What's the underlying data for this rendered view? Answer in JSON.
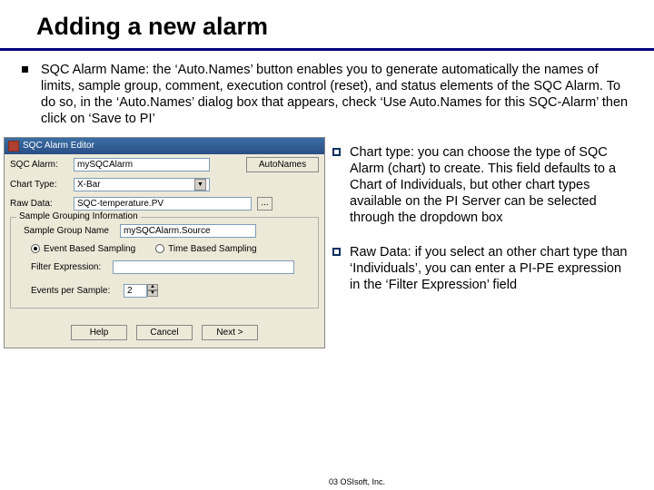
{
  "title": "Adding a new alarm",
  "bullet_main": "SQC Alarm Name: the ‘Auto.Names’ button enables you to generate automatically the names of limits, sample group, comment, execution control (reset), and status elements of the SQC Alarm. To do so, in the ‘Auto.Names’ dialog box that appears, check ‘Use Auto.Names for this SQC-Alarm’ then click on ‘Save to PI’",
  "right_bullets": [
    "Chart type: you can choose the type of SQC Alarm (chart) to create. This field defaults to a Chart of Individuals, but other chart types available on the PI Server can be selected through the dropdown box",
    "Raw Data: if you select an other chart type than ‘Individuals’, you can enter a PI-PE expression in the ‘Filter Expression’ field"
  ],
  "dialog": {
    "title": "SQC Alarm Editor",
    "labels": {
      "sqc_alarm": "SQC Alarm:",
      "chart_type": "Chart Type:",
      "raw_data": "Raw Data:",
      "group_title": "Sample Grouping Information",
      "sample_group": "Sample Group Name",
      "radio_event": "Event Based Sampling",
      "radio_time": "Time Based Sampling",
      "filter": "Filter Expression:",
      "events_per": "Events per Sample:"
    },
    "values": {
      "sqc_alarm": "mySQCAlarm",
      "chart_type": "X-Bar",
      "raw_data": "SQC-temperature.PV",
      "sample_group": "mySQCAlarm.Source",
      "events_per": "2"
    },
    "buttons": {
      "autonames": "AutoNames",
      "help": "Help",
      "cancel": "Cancel",
      "next": "Next >"
    }
  },
  "copyright": "03 OSIsoft, Inc."
}
